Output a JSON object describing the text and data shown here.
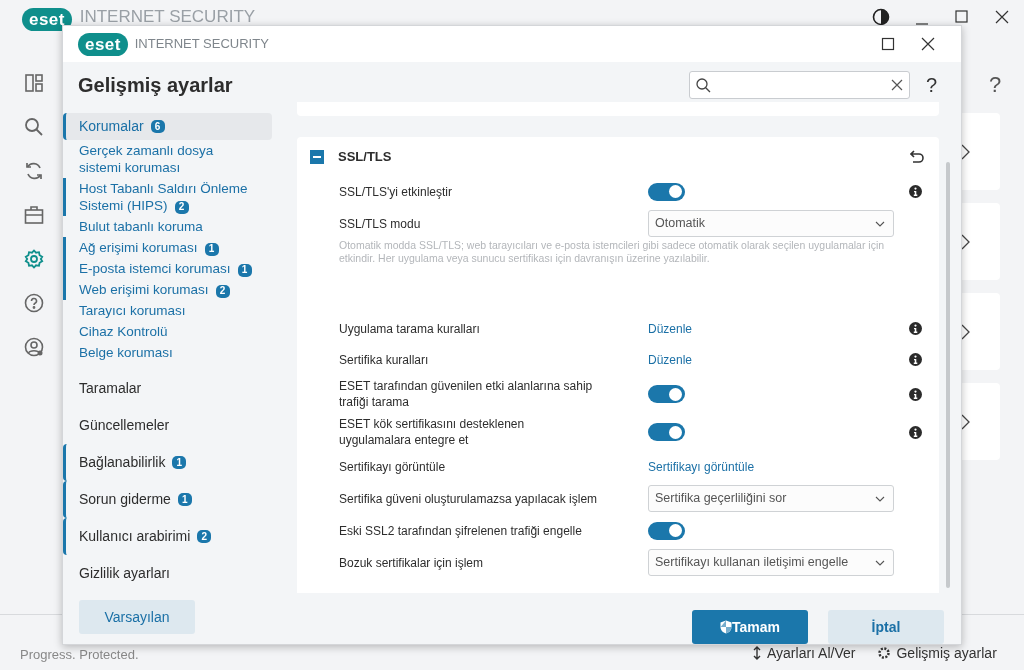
{
  "background_app": {
    "logo": "eset",
    "product": "INTERNET SECURITY",
    "nav": [
      {
        "kind": "dashboard",
        "selected": false
      },
      {
        "kind": "search",
        "selected": false
      },
      {
        "kind": "refresh",
        "selected": false
      },
      {
        "kind": "briefcase",
        "selected": false
      },
      {
        "kind": "gear",
        "selected": true
      },
      {
        "kind": "help",
        "selected": false
      },
      {
        "kind": "user",
        "selected": false
      }
    ],
    "help": "?",
    "footer": {
      "status": "Progress. Protected.",
      "import_export": "Ayarları Al/Ver",
      "advanced": "Gelişmiş ayarlar"
    }
  },
  "dialog": {
    "logo": "eset",
    "product": "INTERNET SECURITY",
    "title": "Gelişmiş ayarlar",
    "help": "?",
    "sidebar": [
      {
        "label": "Korumalar",
        "badge": "6",
        "selected": true,
        "children": [
          {
            "label": "Gerçek zamanlı dosya sistemi koruması"
          },
          {
            "label": "Host Tabanlı Saldırı Önleme Sistemi (HIPS)",
            "badge": "2"
          },
          {
            "label": "Bulut tabanlı koruma"
          },
          {
            "label": "Ağ erişimi koruması",
            "badge": "1"
          },
          {
            "label": "E-posta istemci koruması",
            "badge": "1"
          },
          {
            "label": "Web erişimi koruması",
            "badge": "2"
          },
          {
            "label": "Tarayıcı koruması"
          },
          {
            "label": "Cihaz Kontrolü"
          },
          {
            "label": "Belge koruması"
          }
        ]
      },
      {
        "label": "Taramalar",
        "selected": false
      },
      {
        "label": "Güncellemeler",
        "selected": false
      },
      {
        "label": "Bağlanabilirlik",
        "badge": "1",
        "selected": false
      },
      {
        "label": "Sorun giderme",
        "badge": "1",
        "selected": false
      },
      {
        "label": "Kullanıcı arabirimi",
        "badge": "2",
        "selected": false
      },
      {
        "label": "Gizlilik ayarları",
        "selected": false
      }
    ],
    "section": {
      "title": "SSL/TLS",
      "expanded": true,
      "rows": [
        {
          "kind": "toggle",
          "label": "SSL/TLS'yi etkinleştir",
          "on": true,
          "info": true
        },
        {
          "kind": "select",
          "label": "SSL/TLS modu",
          "value": "Otomatik",
          "info": false
        },
        {
          "kind": "note",
          "text": "Otomatik modda SSL/TLS; web tarayıcıları ve e-posta istemcileri gibi sadece otomatik olarak seçilen uygulamalar için etkindir. Her uygulama veya sunucu sertifikası için davranışın üzerine yazılabilir."
        },
        {
          "kind": "link",
          "label": "Uygulama tarama kuralları",
          "link": "Düzenle",
          "info": true
        },
        {
          "kind": "link",
          "label": "Sertifika kuralları",
          "link": "Düzenle",
          "info": true
        },
        {
          "kind": "toggle",
          "label": "ESET tarafından güvenilen etki alanlarına sahip trafiği tarama",
          "on": true,
          "info": true
        },
        {
          "kind": "toggle",
          "label": "ESET kök sertifikasını desteklenen uygulamalara entegre et",
          "on": true,
          "info": true
        },
        {
          "kind": "link",
          "label": "Sertifikayı görüntüle",
          "link": "Sertifikayı görüntüle",
          "info": false
        },
        {
          "kind": "select",
          "label": "Sertifika güveni oluşturulamazsa yapılacak işlem",
          "value": "Sertifika geçerliliğini sor",
          "info": false
        },
        {
          "kind": "toggle",
          "label": "Eski SSL2 tarafından şifrelenen trafiği engelle",
          "on": true,
          "info": false
        },
        {
          "kind": "select",
          "label": "Bozuk sertifikalar için işlem",
          "value": "Sertifikayı kullanan iletişimi engelle",
          "info": false
        }
      ]
    },
    "buttons": {
      "default": "Varsayılan",
      "ok": "Tamam",
      "cancel": "İptal"
    }
  }
}
